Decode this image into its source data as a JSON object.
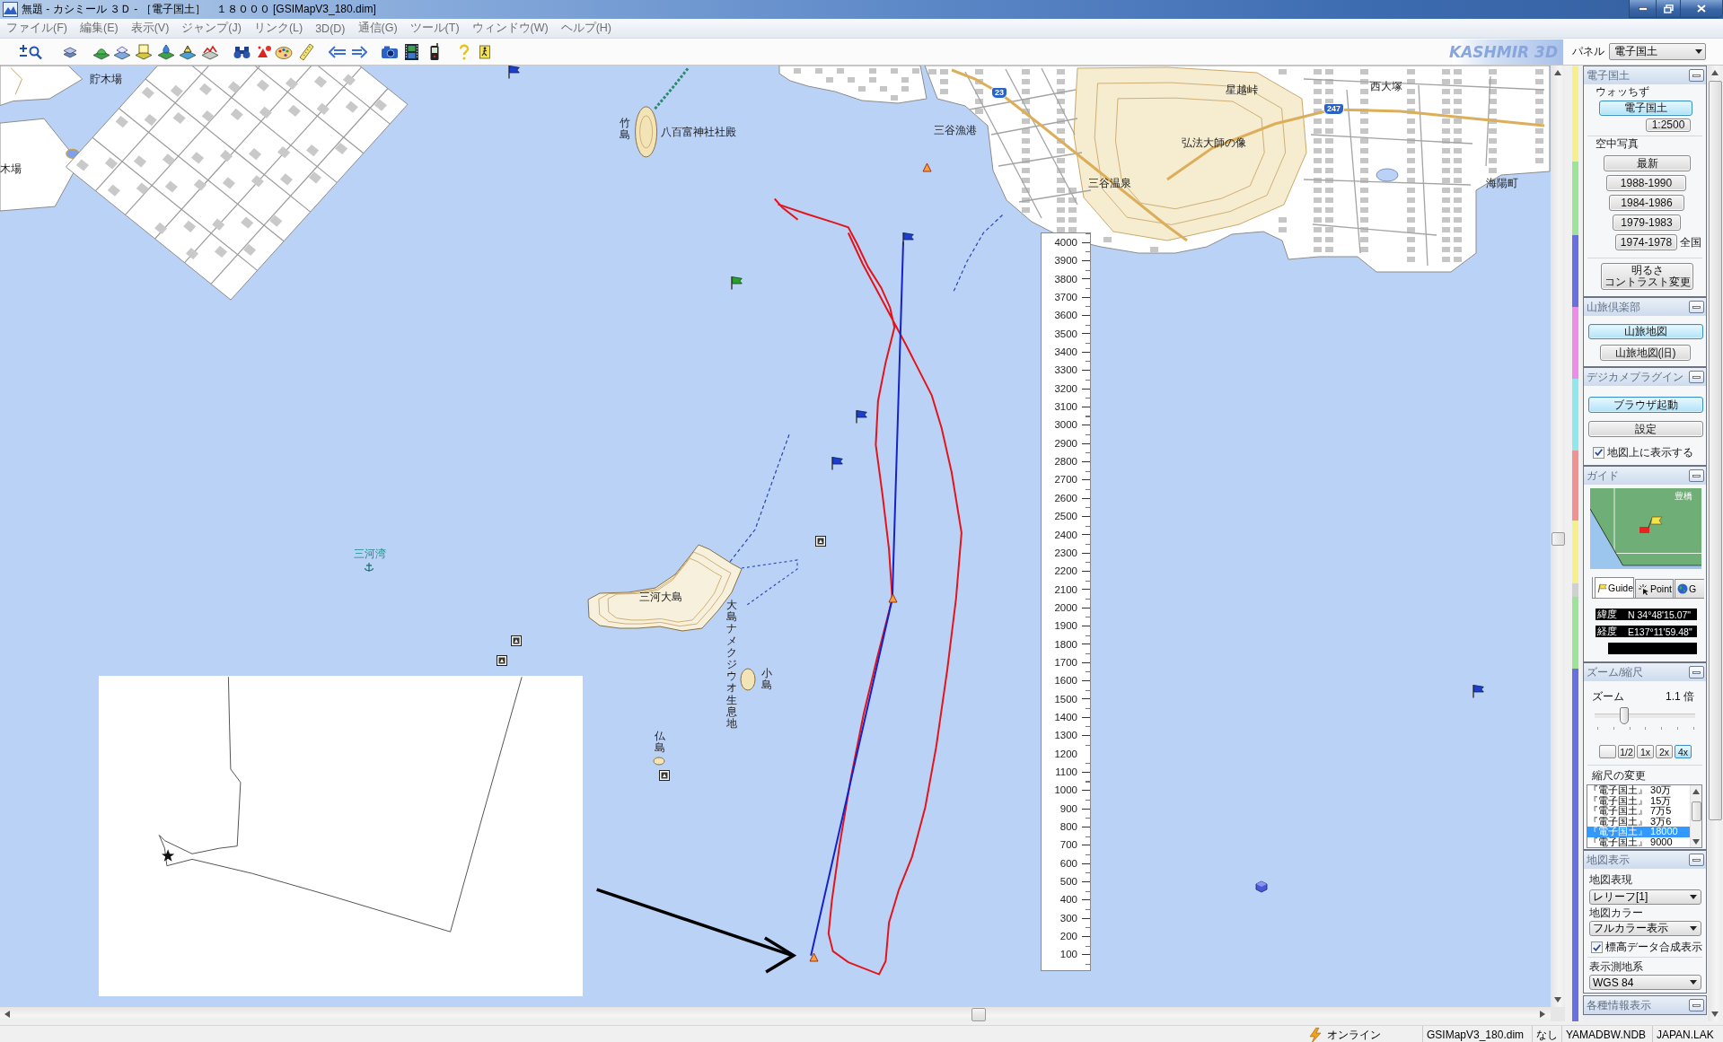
{
  "window": {
    "title": "無題 - カシミール ３Ｄ - ［電子国土］　１８０００ [GSIMapV3_180.dim]"
  },
  "menu": [
    "ファイル(F)",
    "編集(E)",
    "表示(V)",
    "ジャンプ(J)",
    "リンク(L)",
    "3D(D)",
    "通信(G)",
    "ツール(T)",
    "ウィンドウ(W)",
    "ヘルプ(H)"
  ],
  "toolbar": {
    "logo": "KASHMIR 3D",
    "panel_label": "パネル",
    "panel_select": "電子国土"
  },
  "map": {
    "labels": [
      {
        "text": "貯木場",
        "kind": "place"
      },
      {
        "text": "木場",
        "kind": "place"
      },
      {
        "text": "竹島",
        "kind": "vertical"
      },
      {
        "text": "八百富神社社殿",
        "kind": "place"
      },
      {
        "text": "三谷漁港",
        "kind": "place"
      },
      {
        "text": "三谷温泉",
        "kind": "place"
      },
      {
        "text": "三河湾",
        "kind": "water"
      },
      {
        "text": "三河大島",
        "kind": "place"
      },
      {
        "text": "大島ナメクジウオ生息地",
        "kind": "vertical"
      },
      {
        "text": "小島",
        "kind": "vertical"
      },
      {
        "text": "仏島",
        "kind": "vertical"
      },
      {
        "text": "弘法大師の像",
        "kind": "place"
      },
      {
        "text": "星越峠",
        "kind": "place"
      },
      {
        "text": "西大塚",
        "kind": "place"
      },
      {
        "text": "海陽町",
        "kind": "place"
      }
    ],
    "route_shields": [
      "23",
      "247"
    ],
    "elevation_scale": [
      "4000",
      "3900",
      "3800",
      "3700",
      "3600",
      "3500",
      "3400",
      "3300",
      "3200",
      "3100",
      "3000",
      "2900",
      "2800",
      "2700",
      "2600",
      "2500",
      "2400",
      "2300",
      "2200",
      "2100",
      "2000",
      "1900",
      "1800",
      "1700",
      "1600",
      "1500",
      "1400",
      "1300",
      "1200",
      "1100",
      "1000",
      "900",
      "800",
      "700",
      "600",
      "500",
      "400",
      "300",
      "200",
      "100"
    ]
  },
  "panel": {
    "sections": [
      {
        "title": "電子国土",
        "items": [
          {
            "kind": "label",
            "label": "ウォッちず"
          },
          {
            "kind": "button",
            "label": "電子国土",
            "selected": true
          },
          {
            "kind": "button",
            "label": "1:2500",
            "selected": false
          },
          {
            "kind": "divider"
          },
          {
            "kind": "label",
            "label": "空中写真"
          },
          {
            "kind": "button",
            "label": "最新",
            "selected": false
          },
          {
            "kind": "button",
            "label": "1988-1990",
            "selected": false
          },
          {
            "kind": "button",
            "label": "1984-1986",
            "selected": false
          },
          {
            "kind": "button",
            "label": "1979-1983",
            "selected": false
          },
          {
            "kind": "button",
            "label": "1974-1978",
            "selected": false,
            "side_label": "全国"
          },
          {
            "kind": "divider"
          },
          {
            "kind": "button",
            "lines": [
              "明るさ",
              "コントラスト変更"
            ],
            "selected": false
          }
        ]
      },
      {
        "title": "山旅倶楽部",
        "items": [
          {
            "kind": "button",
            "label": "山旅地図",
            "selected": true
          },
          {
            "kind": "button",
            "label": "山旅地図(旧)",
            "selected": false
          }
        ]
      },
      {
        "title": "デジカメプラグイン",
        "items": [
          {
            "kind": "button",
            "label": "ブラウザ起動",
            "selected": true
          },
          {
            "kind": "button",
            "label": "設定",
            "selected": false
          },
          {
            "kind": "checkbox",
            "label": "地図上に表示する",
            "checked": true
          }
        ]
      },
      {
        "title": "ガイド",
        "items": [
          {
            "kind": "guide_map",
            "label": "豊橋"
          },
          {
            "kind": "tabs",
            "tabs": [
              {
                "label": "Guide",
                "selected": true
              },
              {
                "label": "Point",
                "selected": false
              },
              {
                "label": "G",
                "selected": false
              }
            ]
          },
          {
            "kind": "readout",
            "label": "緯度",
            "value": "N 34°48'15.07\""
          },
          {
            "kind": "readout",
            "label": "経度",
            "value": "E137°11'59.48\""
          },
          {
            "kind": "readout"
          }
        ]
      },
      {
        "title": "ズーム/縮尺",
        "items": [
          {
            "kind": "slider",
            "label": "ズーム",
            "reading": "1.1 倍",
            "level": 0.27
          },
          {
            "kind": "button_row",
            "buttons": [
              {
                "selected": false
              },
              {
                "label": "1/2",
                "selected": false
              },
              {
                "label": "1x",
                "selected": false
              },
              {
                "label": "2x",
                "selected": false
              },
              {
                "label": "4x",
                "selected": true
              }
            ]
          },
          {
            "kind": "divider"
          },
          {
            "kind": "label",
            "label": "縮尺の変更"
          },
          {
            "kind": "listbox",
            "options": [
              {
                "label": "『電子国土』 30万",
                "selected": false
              },
              {
                "label": "『電子国土』 15万",
                "selected": false
              },
              {
                "label": "『電子国土』 7万5",
                "selected": false
              },
              {
                "label": "『電子国土』 3万6",
                "selected": false
              },
              {
                "label": "『電子国土』 18000",
                "selected": true
              },
              {
                "label": "『電子国土』 9000",
                "selected": false
              }
            ]
          }
        ]
      },
      {
        "title": "地図表示",
        "items": [
          {
            "kind": "label",
            "label": "地図表現"
          },
          {
            "kind": "dropdown",
            "value": "レリーフ[1]"
          },
          {
            "kind": "label",
            "label": "地図カラー"
          },
          {
            "kind": "dropdown",
            "value": "フルカラー表示"
          },
          {
            "kind": "checkbox",
            "label": "標高データ合成表示",
            "checked": true
          },
          {
            "kind": "divider"
          },
          {
            "kind": "label",
            "label": "表示測地系"
          },
          {
            "kind": "dropdown",
            "value": "WGS 84"
          }
        ]
      },
      {
        "title": "各種情報表示"
      }
    ]
  },
  "status_bar": {
    "connection": "オンライン",
    "cells": [
      "GSIMapV3_180.dim",
      "なし",
      "YAMADBW.NDB",
      "JAPAN.LAK"
    ]
  }
}
